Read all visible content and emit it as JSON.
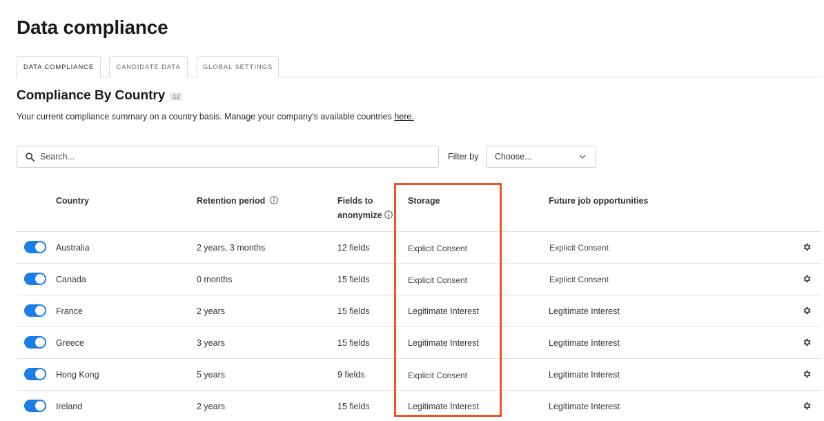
{
  "page": {
    "title": "Data compliance"
  },
  "tabs": [
    {
      "label": "DATA COMPLIANCE",
      "active": true
    },
    {
      "label": "CANDIDATE DATA",
      "active": false
    },
    {
      "label": "GLOBAL SETTINGS",
      "active": false
    }
  ],
  "section": {
    "title": "Compliance By Country",
    "count": "12",
    "summary_text": "Your current compliance summary on a country basis. Manage your company's available countries ",
    "summary_link": "here."
  },
  "search": {
    "placeholder": "Search...",
    "icon": "search-icon"
  },
  "filter": {
    "label": "Filter by",
    "value": "Choose...",
    "icon": "chevron-down-icon"
  },
  "table": {
    "headers": {
      "country": "Country",
      "retention": "Retention period",
      "fields_line1": "Fields to",
      "fields_line2": "anonymize",
      "storage": "Storage",
      "future": "Future job opportunities"
    },
    "rows": [
      {
        "country": "Australia",
        "retention": "2 years, 3 months",
        "fields": "12 fields",
        "storage": "Explicit Consent",
        "future": "Explicit Consent",
        "enabled": true
      },
      {
        "country": "Canada",
        "retention": "0 months",
        "fields": "15 fields",
        "storage": "Explicit Consent",
        "future": "Explicit Consent",
        "enabled": true
      },
      {
        "country": "France",
        "retention": "2 years",
        "fields": "15 fields",
        "storage": "Legitimate Interest",
        "future": "Legitimate Interest",
        "enabled": true
      },
      {
        "country": "Greece",
        "retention": "3 years",
        "fields": "15 fields",
        "storage": "Legitimate Interest",
        "future": "Legitimate Interest",
        "enabled": true
      },
      {
        "country": "Hong Kong",
        "retention": "5 years",
        "fields": "9 fields",
        "storage": "Explicit Consent",
        "future": "Legitimate Interest",
        "enabled": true
      },
      {
        "country": "Ireland",
        "retention": "2 years",
        "fields": "15 fields",
        "storage": "Legitimate Interest",
        "future": "Legitimate Interest",
        "enabled": true
      }
    ]
  },
  "colors": {
    "toggle_on": "#1a7ee8",
    "highlight": "#f0541e"
  }
}
